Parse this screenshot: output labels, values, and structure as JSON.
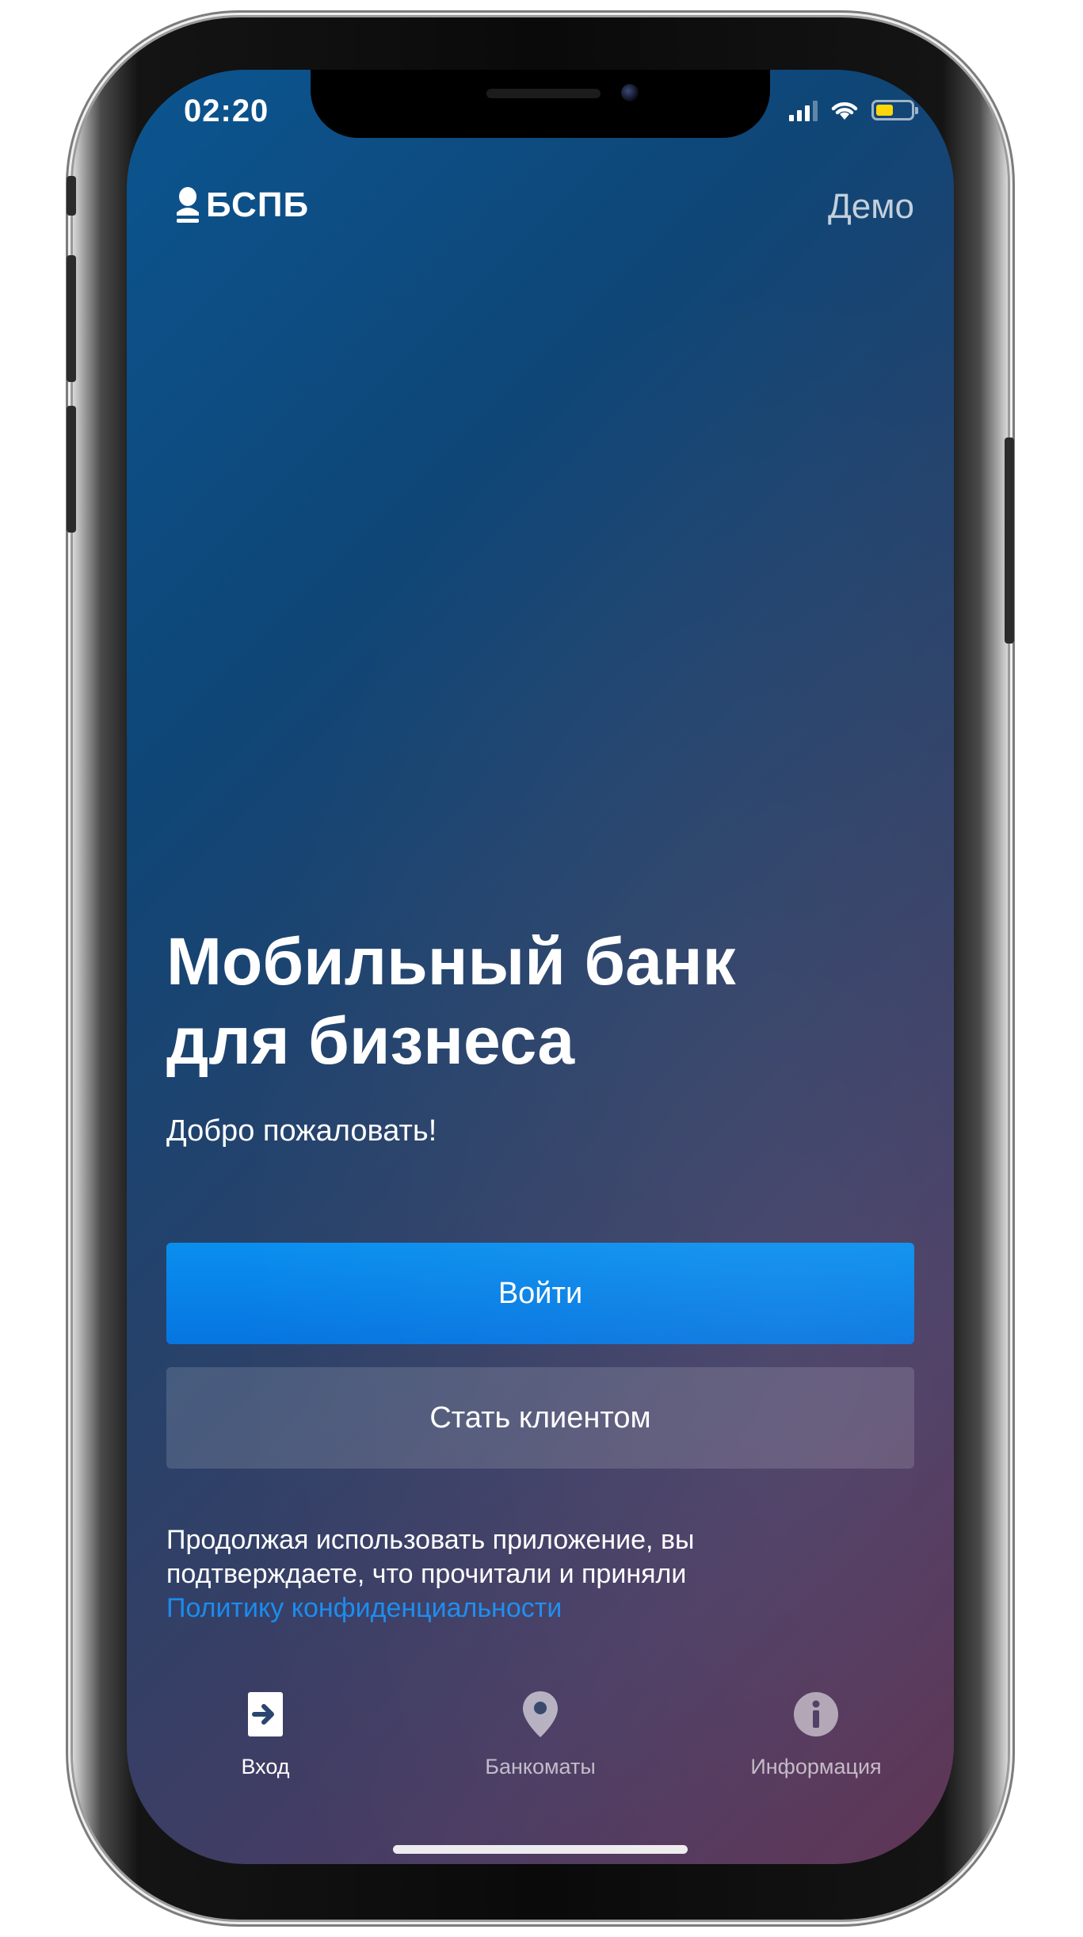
{
  "status_bar": {
    "time": "02:20",
    "icons": [
      "cellular-signal-icon",
      "wifi-icon",
      "battery-icon"
    ],
    "battery_level": 0.5,
    "battery_color": "#ffd60a"
  },
  "header": {
    "logo_text": "БСПБ",
    "logo_icon": "bspb-logo-icon",
    "demo_label": "Демо"
  },
  "main": {
    "title_line1": "Мобильный банк",
    "title_line2": "для бизнеса",
    "subtitle": "Добро пожаловать!",
    "login_button": "Войти",
    "become_client_button": "Стать клиентом",
    "legal_text_line1": "Продолжая использовать приложение, вы",
    "legal_text_line2": "подтверждаете, что прочитали и приняли",
    "privacy_link": "Политику конфиденциальности"
  },
  "tabbar": {
    "items": [
      {
        "label": "Вход",
        "icon": "login-arrow-icon",
        "active": true
      },
      {
        "label": "Банкоматы",
        "icon": "map-pin-icon",
        "active": false
      },
      {
        "label": "Информация",
        "icon": "info-icon",
        "active": false
      }
    ]
  },
  "colors": {
    "primary_button": "#0a84ea",
    "link": "#1a8cf0",
    "background_top": "#0c5590",
    "background_bottom": "#5b2f50"
  }
}
